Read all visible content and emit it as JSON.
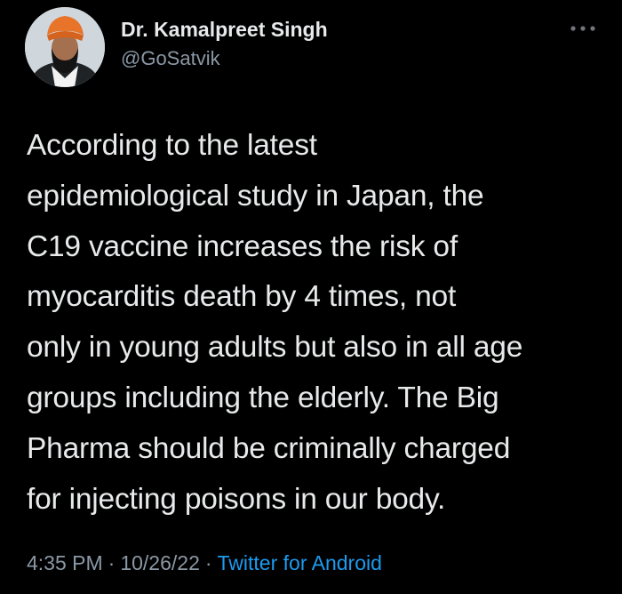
{
  "author": {
    "display_name": "Dr. Kamalpreet Singh",
    "handle": "@GoSatvik",
    "avatar_icon": "profile-photo"
  },
  "menu": {
    "icon": "more-horizontal-icon"
  },
  "tweet": {
    "text": "According to the latest\nepidemiological study in Japan, the\nC19 vaccine increases the risk of\nmyocarditis death by 4 times, not\nonly in young adults but also in all age\ngroups including the elderly. The Big\nPharma should be criminally charged\nfor injecting poisons in our body.",
    "time": "4:35 PM",
    "date": "10/26/22",
    "separator": "·",
    "source": "Twitter for Android"
  },
  "colors": {
    "background": "#000000",
    "primary_text": "#e7e9ea",
    "secondary_text": "#8b98a5",
    "accent": "#1d9bf0"
  }
}
